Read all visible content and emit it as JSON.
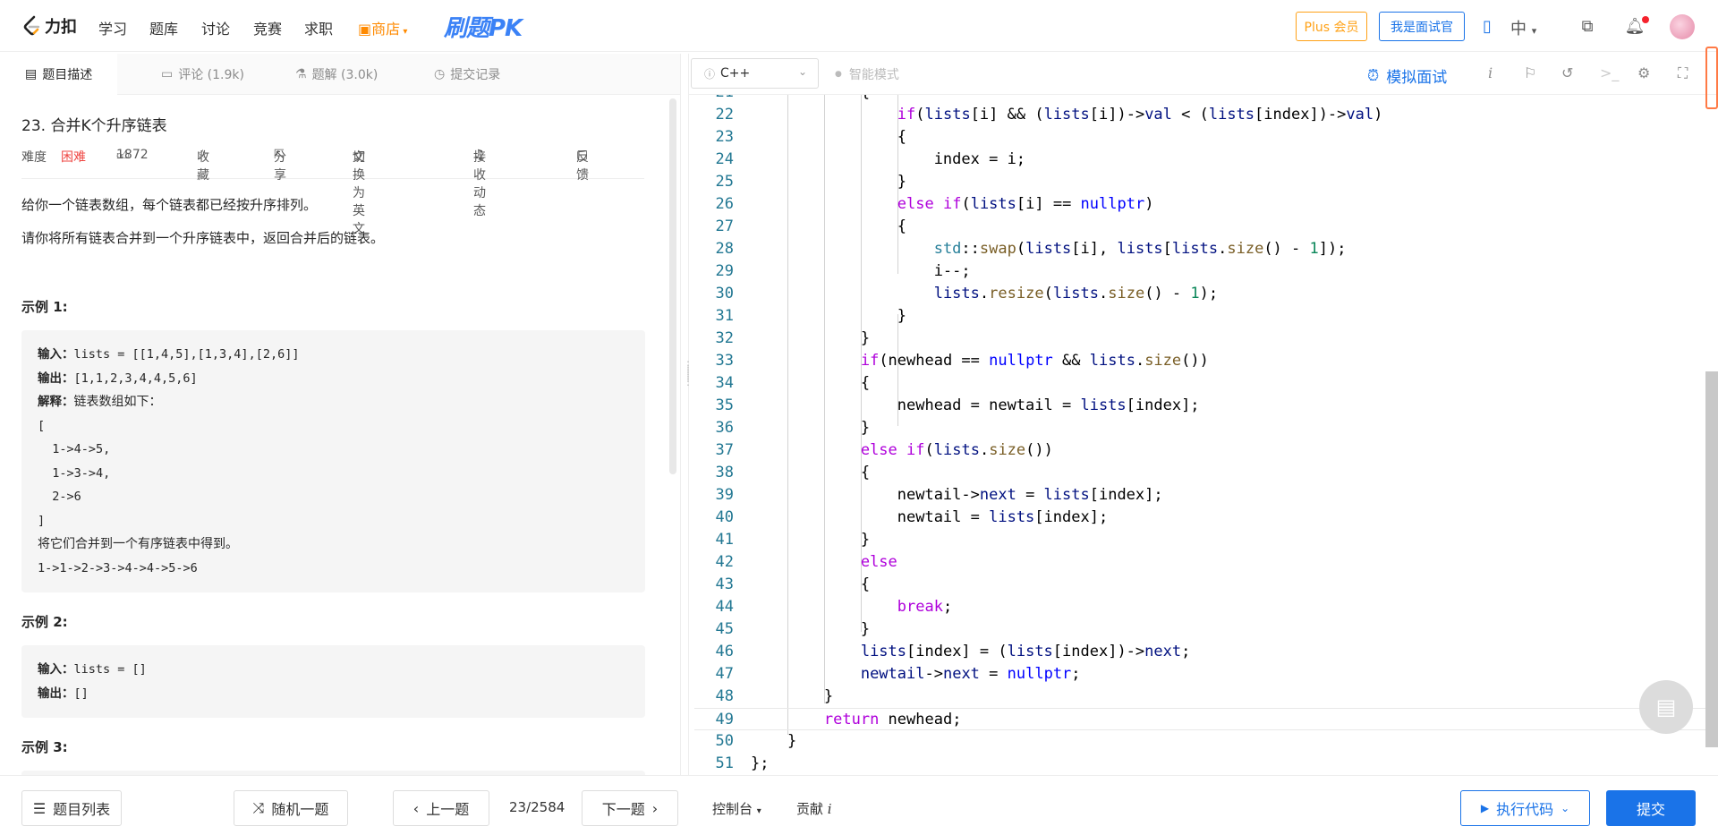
{
  "nav": {
    "logo_text": "力扣",
    "links": [
      "学习",
      "题库",
      "讨论",
      "竞赛",
      "求职"
    ],
    "shop": "商店",
    "pk": "刷题PK",
    "plus": "Plus 会员",
    "interviewer": "我是面试官",
    "lang": "中"
  },
  "tabs": {
    "desc": "题目描述",
    "comments": "评论 (1.9k)",
    "solutions": "题解 (3.0k)",
    "submissions": "提交记录"
  },
  "problem": {
    "title": "23. 合并K个升序链表",
    "difficulty_label": "难度",
    "difficulty": "困难",
    "likes": "1872",
    "collect": "收藏",
    "share": "分享",
    "switch_en": "切换为英文",
    "notify": "接收动态",
    "feedback": "反馈",
    "p1": "给你一个链表数组，每个链表都已经按升序排列。",
    "p2": "请你将所有链表合并到一个升序链表中，返回合并后的链表。",
    "ex1_title": "示例 1:",
    "ex1": {
      "in_label": "输入：",
      "in_val": "lists = [[1,4,5],[1,3,4],[2,6]]",
      "out_label": "输出：",
      "out_val": "[1,1,2,3,4,4,5,6]",
      "exp_label": "解释：",
      "exp_val": "链表数组如下：",
      "l1": "[",
      "l2": "  1->4->5,",
      "l3": "  1->3->4,",
      "l4": "  2->6",
      "l5": "]",
      "l6": "将它们合并到一个有序链表中得到。",
      "l7": "1->1->2->3->4->4->5->6"
    },
    "ex2_title": "示例 2:",
    "ex2": {
      "in_label": "输入：",
      "in_val": "lists = []",
      "out_label": "输出：",
      "out_val": "[]"
    },
    "ex3_title": "示例 3:"
  },
  "editor": {
    "language": "C++",
    "smart_mode": "智能模式",
    "mock_interview": "模拟面试"
  },
  "bottom": {
    "list": "题目列表",
    "random": "随机一题",
    "prev": "上一题",
    "page": "23/2584",
    "next": "下一题",
    "console": "控制台",
    "contrib": "贡献",
    "run": "执行代码",
    "submit": "提交"
  },
  "colors": {
    "accent": "#1a73e8",
    "hard": "#ef4743",
    "plus": "#ffa116"
  }
}
